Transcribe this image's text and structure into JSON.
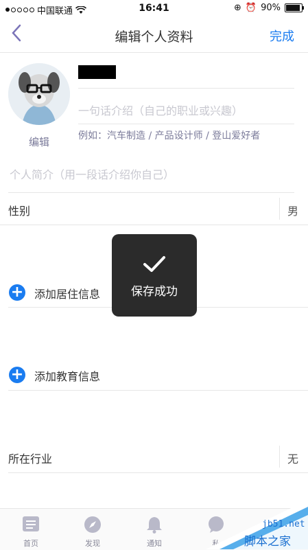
{
  "status_bar": {
    "carrier": "中国联通",
    "time": "16:41",
    "battery_percent": "90%",
    "battery_level": 0.9
  },
  "nav": {
    "title": "编辑个人资料",
    "done_label": "完成",
    "back_icon": "chevron-left-icon"
  },
  "profile": {
    "avatar_edit_label": "编辑",
    "intro_placeholder": "一句话介绍（自己的职业或兴趣）",
    "intro_example": "例如：汽车制造 / 产品设计师 / 登山爱好者",
    "bio_placeholder": "个人简介（用一段话介绍你自己）"
  },
  "fields": {
    "gender_label": "性别",
    "gender_value": "男",
    "add_residence_label": "添加居住信息",
    "add_education_label": "添加教育信息",
    "industry_label": "所在行业",
    "industry_value": "无"
  },
  "toast": {
    "text": "保存成功"
  },
  "tabbar": {
    "items": [
      {
        "label": "首页",
        "icon": "home-icon"
      },
      {
        "label": "发现",
        "icon": "compass-icon"
      },
      {
        "label": "通知",
        "icon": "bell-icon"
      },
      {
        "label": "私",
        "icon": "chat-icon"
      }
    ]
  },
  "watermark": {
    "site": "jb51.net",
    "name": "脚本之家"
  },
  "colors": {
    "accent": "#1a7cf0",
    "nav_back": "#7b74b8",
    "toast_bg": "#2b2b2b"
  }
}
